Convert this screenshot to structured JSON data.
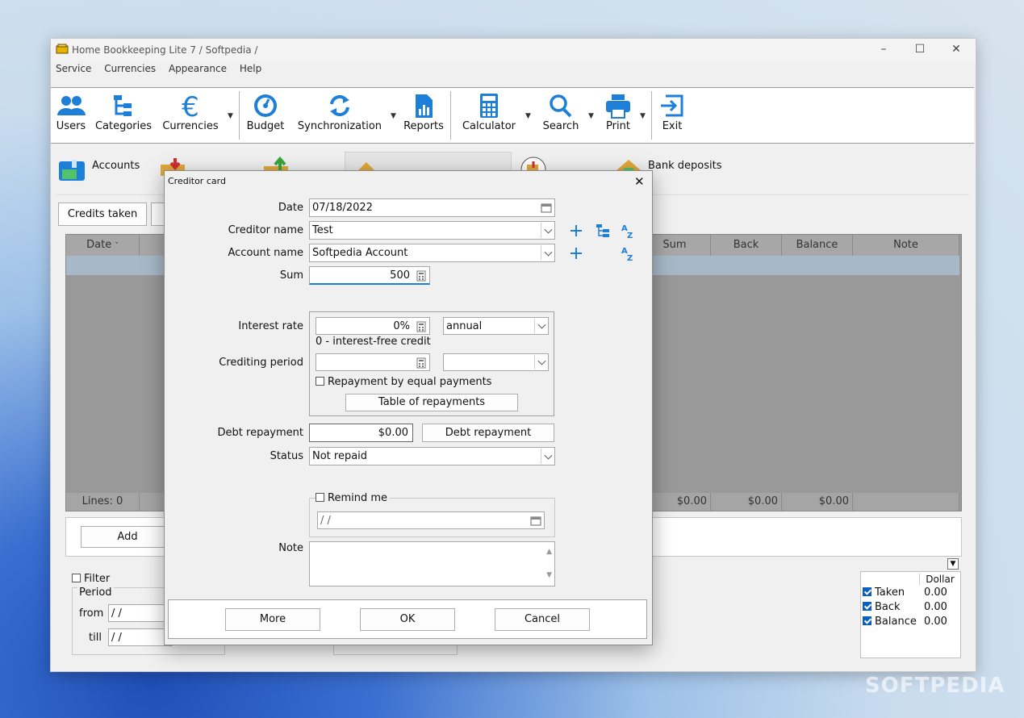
{
  "window": {
    "title": "Home Bookkeeping Lite 7 / Softpedia /"
  },
  "menu": [
    "Service",
    "Currencies",
    "Appearance",
    "Help"
  ],
  "toolbar": {
    "users": "Users",
    "categories": "Categories",
    "currencies": "Currencies",
    "budget": "Budget",
    "synchronization": "Synchronization",
    "reports": "Reports",
    "calculator": "Calculator",
    "search": "Search",
    "print": "Print",
    "exit": "Exit"
  },
  "sections": {
    "accounts": "Accounts",
    "bank_deposits": "Bank deposits"
  },
  "tabs": {
    "credits_taken": "Credits taken"
  },
  "grid": {
    "headers": {
      "date": "Date",
      "sum": "Sum",
      "back": "Back",
      "balance": "Balance",
      "note": "Note"
    },
    "footer": {
      "lines": "Lines: 0",
      "sum": "$0.00",
      "back": "$0.00",
      "balance": "$0.00"
    }
  },
  "actions": {
    "add": "Add"
  },
  "filter": {
    "label": "Filter",
    "period": "Period",
    "from": "from",
    "till": "till",
    "from_value": " /  /",
    "till_value": " /  /"
  },
  "summary": {
    "currency": "Dollar",
    "rows": [
      {
        "label": "Taken",
        "value": "0.00"
      },
      {
        "label": "Back",
        "value": "0.00"
      },
      {
        "label": "Balance",
        "value": "0.00"
      }
    ]
  },
  "dialog": {
    "title": "Creditor card",
    "date_label": "Date",
    "date_value": "07/18/2022",
    "creditor_label": "Creditor name",
    "creditor_value": "Test",
    "account_label": "Account name",
    "account_value": "Softpedia Account",
    "sum_label": "Sum",
    "sum_value": "500",
    "interest_label": "Interest rate",
    "interest_value": "0%",
    "interest_period": "annual",
    "interest_hint": "0 - interest-free credit",
    "crediting_label": "Crediting period",
    "equal_payments": "Repayment by equal payments",
    "table_repayments": "Table of repayments",
    "debt_label": "Debt repayment",
    "debt_value": "$0.00",
    "debt_button": "Debt repayment",
    "status_label": "Status",
    "status_value": "Not repaid",
    "remind_label": "Remind me",
    "remind_value": " /  /",
    "note_label": "Note",
    "more": "More",
    "ok": "OK",
    "cancel": "Cancel"
  },
  "watermark": "SOFTPEDIA",
  "colors": {
    "accent": "#1e7fd8",
    "selection": "#0b5fc4"
  }
}
